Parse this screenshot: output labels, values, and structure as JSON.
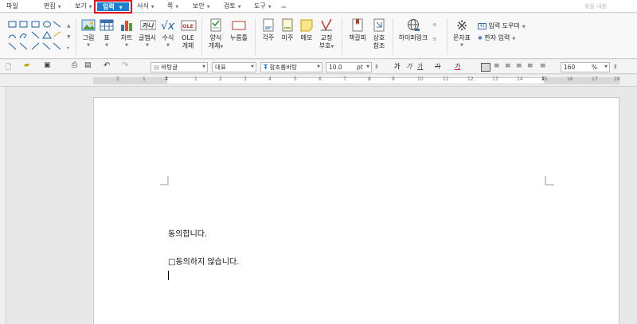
{
  "menubar": {
    "items": [
      {
        "label": "파일"
      },
      {
        "label": "편집"
      },
      {
        "label": "보기"
      },
      {
        "label": "입력",
        "active": true
      },
      {
        "label": "서식"
      },
      {
        "label": "쪽"
      },
      {
        "label": "보안"
      },
      {
        "label": "검토"
      },
      {
        "label": "도구"
      }
    ],
    "search_placeholder": "찾을 내용",
    "active_color": "#1a7fd0",
    "highlight_color": "#e4141b"
  },
  "ribbon": {
    "picture": "그림",
    "table": "표",
    "chart": "차트",
    "wordart": "글맵시",
    "equation": "수식",
    "ole_line1": "OLE",
    "ole_line2": "개체",
    "form_line1": "양식",
    "form_line2": "개체",
    "clickhere": "누름틀",
    "footnote": "각주",
    "endnote": "미주",
    "memo": "메모",
    "proofmark_line1": "교정",
    "proofmark_line2": "부호",
    "bookmark": "책갈피",
    "crossref_line1": "상호",
    "crossref_line2": "참조",
    "hyperlink": "하이퍼링크",
    "symbol": "문자표",
    "input_helper": "입력 도우미",
    "hanja_input": "한자 입력"
  },
  "toolbar": {
    "style": "바탕글",
    "lang": "대표",
    "font": "함초롬바탕",
    "size": "10.0",
    "size_unit": "pt",
    "bold": "가",
    "italic": "가",
    "underline": "가",
    "strike": "가",
    "fontcolor": "가",
    "zoom": "160",
    "zoom_unit": "%"
  },
  "ruler": {
    "numbers": [
      "2",
      "1",
      "1",
      "2",
      "3",
      "4",
      "5",
      "6",
      "7",
      "8",
      "9",
      "10",
      "11",
      "12",
      "13",
      "14",
      "15",
      "16",
      "17",
      "18"
    ]
  },
  "document": {
    "line1": "동의합니다.",
    "line2": "□동의하지  않습니다."
  }
}
